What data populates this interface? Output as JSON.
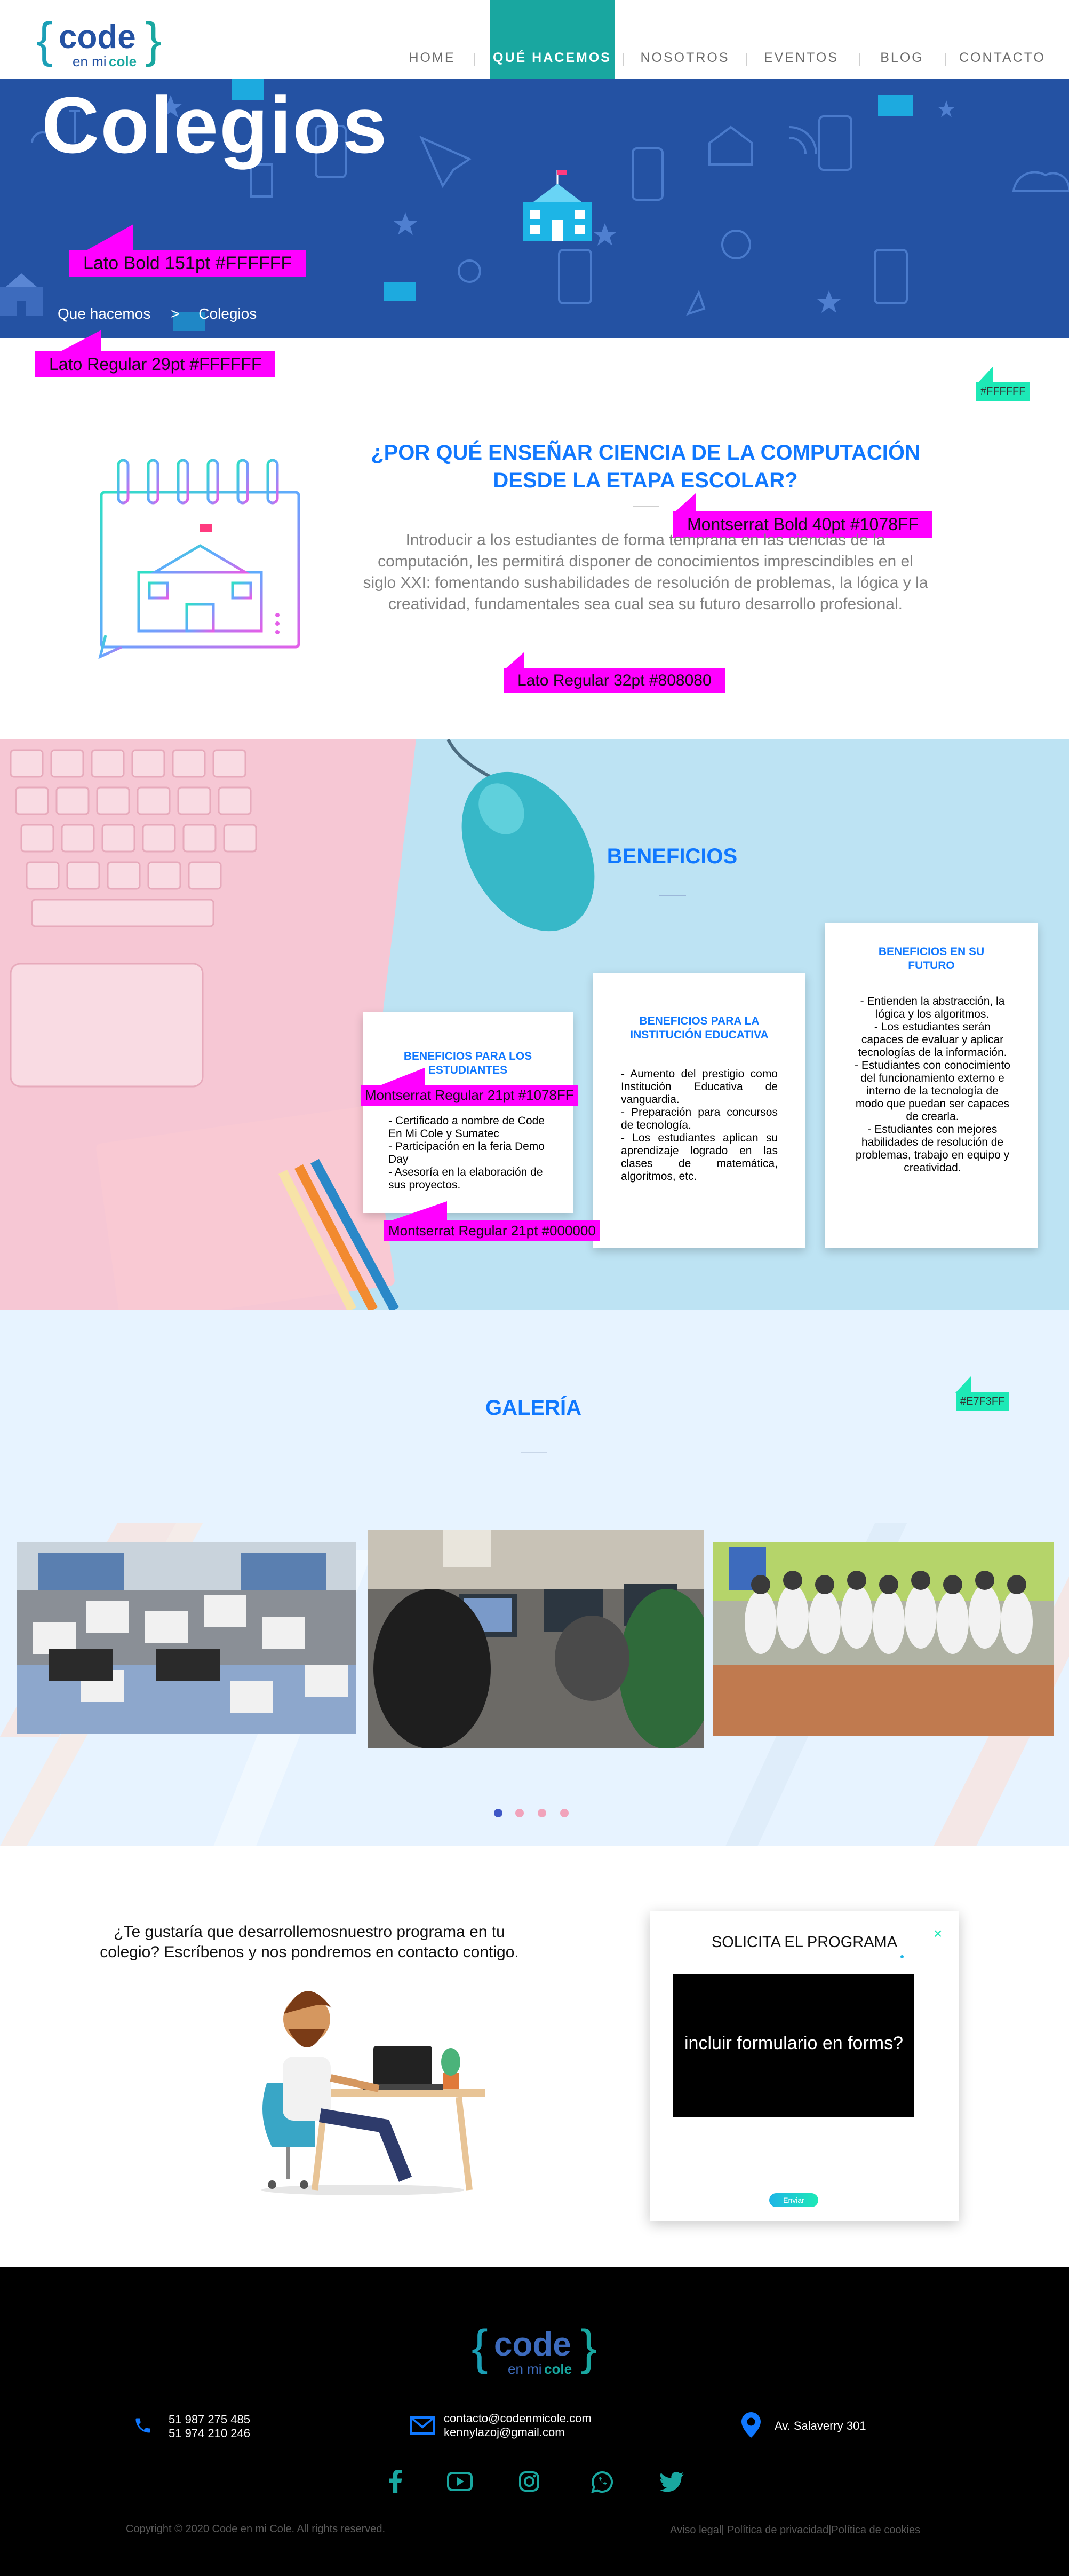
{
  "nav": {
    "items": [
      {
        "label": "HOME"
      },
      {
        "label": "QUÉ HACEMOS"
      },
      {
        "label": "NOSOTROS"
      },
      {
        "label": "EVENTOS"
      },
      {
        "label": "BLOG"
      },
      {
        "label": "CONTACTO"
      }
    ],
    "active_color": "#19A7A0"
  },
  "logo": {
    "brand": "code",
    "tagline_en": "en mi",
    "tagline_cole": "cole"
  },
  "hero": {
    "title": "Colegios",
    "breadcrumb": {
      "parent": "Que hacemos",
      "separator": ">",
      "current": "Colegios"
    },
    "background_color": "#2452A3"
  },
  "annotations": {
    "hero_title_spec": "Lato Bold 151pt #FFFFFF",
    "breadcrumb_spec": "Lato Regular 29pt #FFFFFF",
    "bg_white_spec": "#FFFFFF",
    "why_title_spec": "Montserrat Bold  40pt #1078FF",
    "why_text_spec": "Lato Regular 32pt #808080",
    "card_title_spec": "Montserrat Regular  21pt #1078FF",
    "card_body_spec": "Montserrat Regular  21pt #000000",
    "gallery_bg_spec": "#E7F3FF"
  },
  "why": {
    "title": "¿POR QUÉ ENSEÑAR CIENCIA DE LA COMPUTACIÓN DESDE LA ETAPA ESCOLAR?",
    "text": "Introducir a los estudiantes de forma temprana en las ciencias de la computación, les  permitirá disponer de conocimientos imprescindibles en el siglo XXI: fomentando sushabilidades de resolución de problemas, la lógica y la creatividad, fundamentales sea cual sea su futuro desarrollo profesional."
  },
  "benefits": {
    "title": "BENEFICIOS",
    "cards": [
      {
        "title": "BENEFICIOS PARA LOS ESTUDIANTES",
        "body": "- Certificado a nombre de Code En Mi Cole y Sumatec\n- Participación en la feria Demo Day\n- Asesoría en la elaboración de sus proyectos."
      },
      {
        "title": "BENEFICIOS PARA LA INSTITUCIÓN EDUCATIVA",
        "body": "- Aumento del prestigio como Institución Educativa de vanguardia.\n- Preparación para concursos de tecnología.\n- Los estudiantes aplican su aprendizaje logrado en las clases de matemática, algoritmos, etc."
      },
      {
        "title": "BENEFICIOS EN SU FUTURO",
        "body": "- Entienden la abstracción, la lógica y los algoritmos.\n- Los estudiantes serán capaces de evaluar y aplicar tecnologías de la información.\n- Estudiantes con conocimiento del funcionamiento externo e interno de la tecnología de modo que puedan ser capaces de crearla.\n- Estudiantes con mejores habilidades de resolución de problemas, trabajo en equipo y creatividad."
      }
    ]
  },
  "gallery": {
    "title": "GALERÍA",
    "dots": 4
  },
  "contact": {
    "question": "¿Te gustaría que desarrollemosnuestro programa en tu colegio? Escríbenos y nos pondremos en contacto contigo.",
    "form_title": "SOLICITA EL PROGRAMA",
    "form_placeholder": "incluir formulario en forms?",
    "send_label": "Enviar"
  },
  "footer": {
    "phone1": "51 987 275 485",
    "phone2": "51 974 210 246",
    "email1": "contacto@codenmicole.com",
    "email2": "kennylazoj@gmail.com",
    "address": "Av. Salaverry 301",
    "copyright": "Copyright © 2020 Code en mi Cole. All rights reserved.",
    "legal": "Aviso legal| Política de privacidad|Política de cookies",
    "socials": [
      "facebook-icon",
      "youtube-icon",
      "instagram-icon",
      "whatsapp-icon",
      "twitter-icon"
    ]
  }
}
